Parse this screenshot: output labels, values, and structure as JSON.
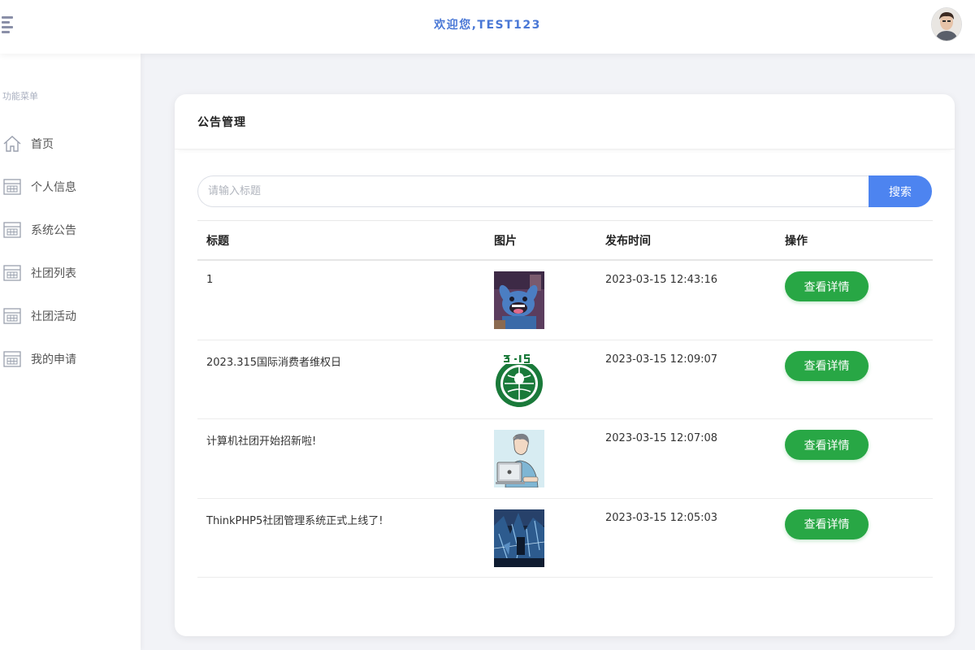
{
  "header": {
    "welcome_text": "欢迎您,TEST123"
  },
  "sidebar": {
    "heading": "功能菜单",
    "items": [
      {
        "label": "首页",
        "icon": "home-icon"
      },
      {
        "label": "个人信息",
        "icon": "grid-table-icon"
      },
      {
        "label": "系统公告",
        "icon": "grid-table-icon"
      },
      {
        "label": "社团列表",
        "icon": "grid-table-icon"
      },
      {
        "label": "社团活动",
        "icon": "grid-table-icon"
      },
      {
        "label": "我的申请",
        "icon": "grid-table-icon"
      }
    ]
  },
  "main": {
    "title": "公告管理",
    "search": {
      "placeholder": "请输入标题",
      "value": "",
      "button_label": "搜索"
    },
    "table": {
      "columns": [
        "标题",
        "图片",
        "发布时间",
        "操作"
      ],
      "rows": [
        {
          "title": "1",
          "image": "cartoon-character-thumbnail",
          "time": "2023-03-15 12:43:16",
          "action": "查看详情"
        },
        {
          "title": "2023.315国际消费者维权日",
          "image": "315-logo-thumbnail",
          "time": "2023-03-15 12:09:07",
          "action": "查看详情"
        },
        {
          "title": "计算机社团开始招新啦!",
          "image": "person-at-computer-thumbnail",
          "time": "2023-03-15 12:07:08",
          "action": "查看详情"
        },
        {
          "title": "ThinkPHP5社团管理系统正式上线了!",
          "image": "abstract-blue-thumbnail",
          "time": "2023-03-15 12:05:03",
          "action": "查看详情"
        }
      ]
    }
  },
  "colors": {
    "accent_blue": "#4d84f0",
    "welcome_blue": "#4a78d6",
    "button_green": "#28a745",
    "logo_green": "#1a7a3a"
  }
}
